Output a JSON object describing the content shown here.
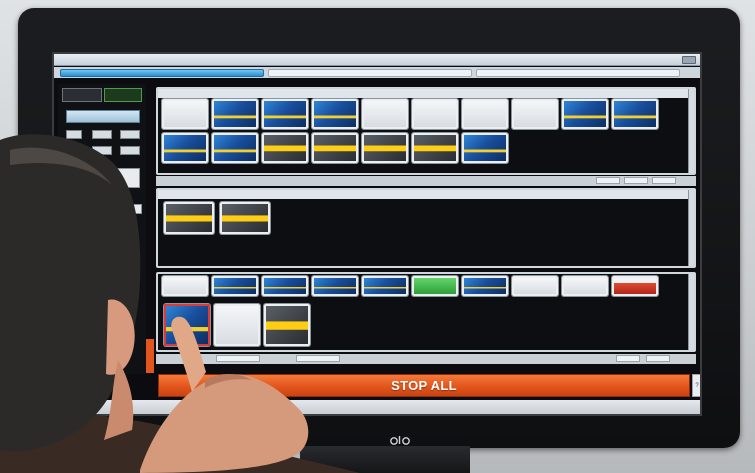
{
  "scene": {
    "description_free": true,
    "monitor_brand_logo": "elo"
  },
  "app": {
    "stop_all_label": "STOP ALL",
    "help_label": "?"
  },
  "colors": {
    "stop_all": "#e2551c",
    "accent_blue": "#2c8fce",
    "tile_gold": "#ffcd14",
    "selected_outline": "#d93b3b"
  },
  "icons": {
    "help": "question-mark-icon"
  }
}
